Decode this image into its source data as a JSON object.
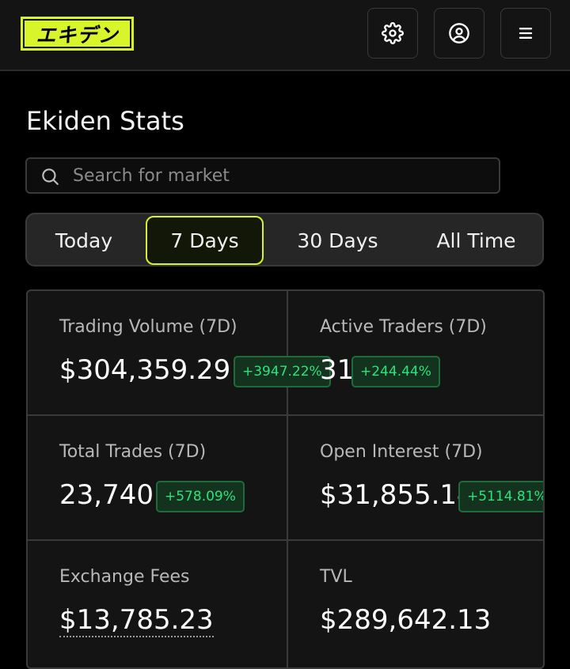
{
  "header": {
    "logo_text": "エキデン",
    "settings_icon": "gear-icon",
    "account_icon": "user-circle-icon",
    "menu_icon": "hamburger-menu-icon"
  },
  "page": {
    "title": "Ekiden Stats"
  },
  "search": {
    "placeholder": "Search for market",
    "value": ""
  },
  "tabs": [
    {
      "label": "Today",
      "active": false
    },
    {
      "label": "7 Days",
      "active": true
    },
    {
      "label": "30 Days",
      "active": false
    },
    {
      "label": "All Time",
      "active": false
    }
  ],
  "stats": [
    {
      "label": "Trading Volume (7D)",
      "value": "$304,359.29",
      "change": "+3947.22%"
    },
    {
      "label": "Active Traders (7D)",
      "value": "31",
      "change": "+244.44%"
    },
    {
      "label": "Total Trades (7D)",
      "value": "23,740",
      "change": "+578.09%"
    },
    {
      "label": "Open Interest (7D)",
      "value": "$31,855.14",
      "change": "+5114.81%"
    },
    {
      "label": "Exchange Fees",
      "value": "$13,785.23"
    },
    {
      "label": "TVL",
      "value": "$289,642.13"
    }
  ],
  "colors": {
    "accent": "#d8f52b",
    "positive": "#2ee27a",
    "background": "#000000",
    "panel": "#141414"
  }
}
